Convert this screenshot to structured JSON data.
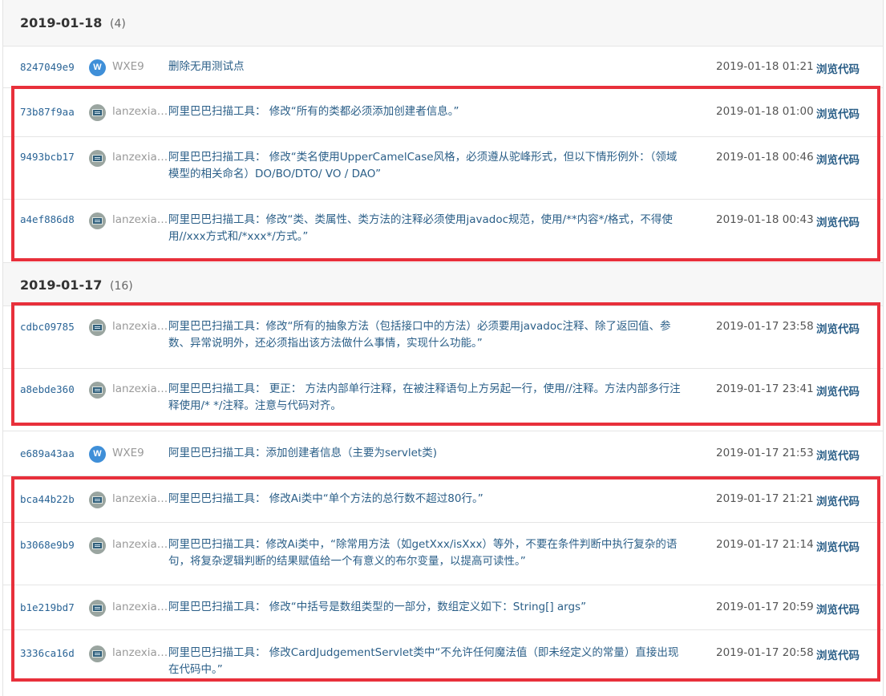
{
  "groups": [
    {
      "date": "2019-01-18",
      "count": "(4)"
    },
    {
      "date": "2019-01-17",
      "count": "(16)"
    }
  ],
  "browse_label": "浏览代码",
  "commits": [
    {
      "sha": "8247049e9",
      "avatar": "W",
      "author": "WXE9",
      "message": "删除无用测试点",
      "time": "2019-01-18 01:21"
    },
    {
      "sha": "73b87f9aa",
      "avatar": "",
      "author": "lanzexiang",
      "message": "阿里巴巴扫描工具： 修改“所有的类都必须添加创建者信息。”",
      "time": "2019-01-18 01:00"
    },
    {
      "sha": "9493bcb17",
      "avatar": "",
      "author": "lanzexiang",
      "message": "阿里巴巴扫描工具： 修改“类名使用UpperCamelCase风格，必须遵从驼峰形式，但以下情形例外：（领域模型的相关命名）DO/BO/DTO/ VO / DAO”",
      "time": "2019-01-18 00:46"
    },
    {
      "sha": "a4ef886d8",
      "avatar": "",
      "author": "lanzexiang",
      "message": "阿里巴巴扫描工具：修改“类、类属性、类方法的注释必须使用javadoc规范，使用/**内容*/格式，不得使用//xxx方式和/*xxx*/方式。”",
      "time": "2019-01-18 00:43"
    },
    {
      "sha": "cdbc09785",
      "avatar": "",
      "author": "lanzexiang",
      "message": "阿里巴巴扫描工具：修改“所有的抽象方法（包括接口中的方法）必须要用javadoc注释、除了返回值、参数、异常说明外，还必须指出该方法做什么事情，实现什么功能。”",
      "time": "2019-01-17 23:58"
    },
    {
      "sha": "a8ebde360",
      "avatar": "",
      "author": "lanzexiang",
      "message": "阿里巴巴扫描工具： 更正： 方法内部单行注释，在被注释语句上方另起一行，使用//注释。方法内部多行注释使用/* */注释。注意与代码对齐。",
      "time": "2019-01-17 23:41"
    },
    {
      "sha": "e689a43aa",
      "avatar": "W",
      "author": "WXE9",
      "message": "阿里巴巴扫描工具：添加创建者信息（主要为servlet类)",
      "time": "2019-01-17 21:53"
    },
    {
      "sha": "bca44b22b",
      "avatar": "",
      "author": "lanzexiang",
      "message": "阿里巴巴扫描工具： 修改Ai类中“单个方法的总行数不超过80行。”",
      "time": "2019-01-17 21:21"
    },
    {
      "sha": "b3068e9b9",
      "avatar": "",
      "author": "lanzexiang",
      "message": "阿里巴巴扫描工具：修改Ai类中，“除常用方法（如getXxx/isXxx）等外，不要在条件判断中执行复杂的语句，将复杂逻辑判断的结果赋值给一个有意义的布尔变量，以提高可读性。”",
      "time": "2019-01-17 21:14"
    },
    {
      "sha": "b1e219bd7",
      "avatar": "",
      "author": "lanzexiang",
      "message": "阿里巴巴扫描工具： 修改“中括号是数组类型的一部分，数组定义如下：String[] args”",
      "time": "2019-01-17 20:59"
    },
    {
      "sha": "3336ca16d",
      "avatar": "",
      "author": "lanzexiang",
      "message": "阿里巴巴扫描工具： 修改CardJudgementServlet类中“不允许任何魔法值（即未经定义的常量）直接出现在代码中。”",
      "time": "2019-01-17 20:58"
    }
  ],
  "colors": {
    "highlight": "#e8303b",
    "link": "#2b5f88",
    "sha": "#2a6496",
    "avatar_w": "#3f8fd8"
  }
}
